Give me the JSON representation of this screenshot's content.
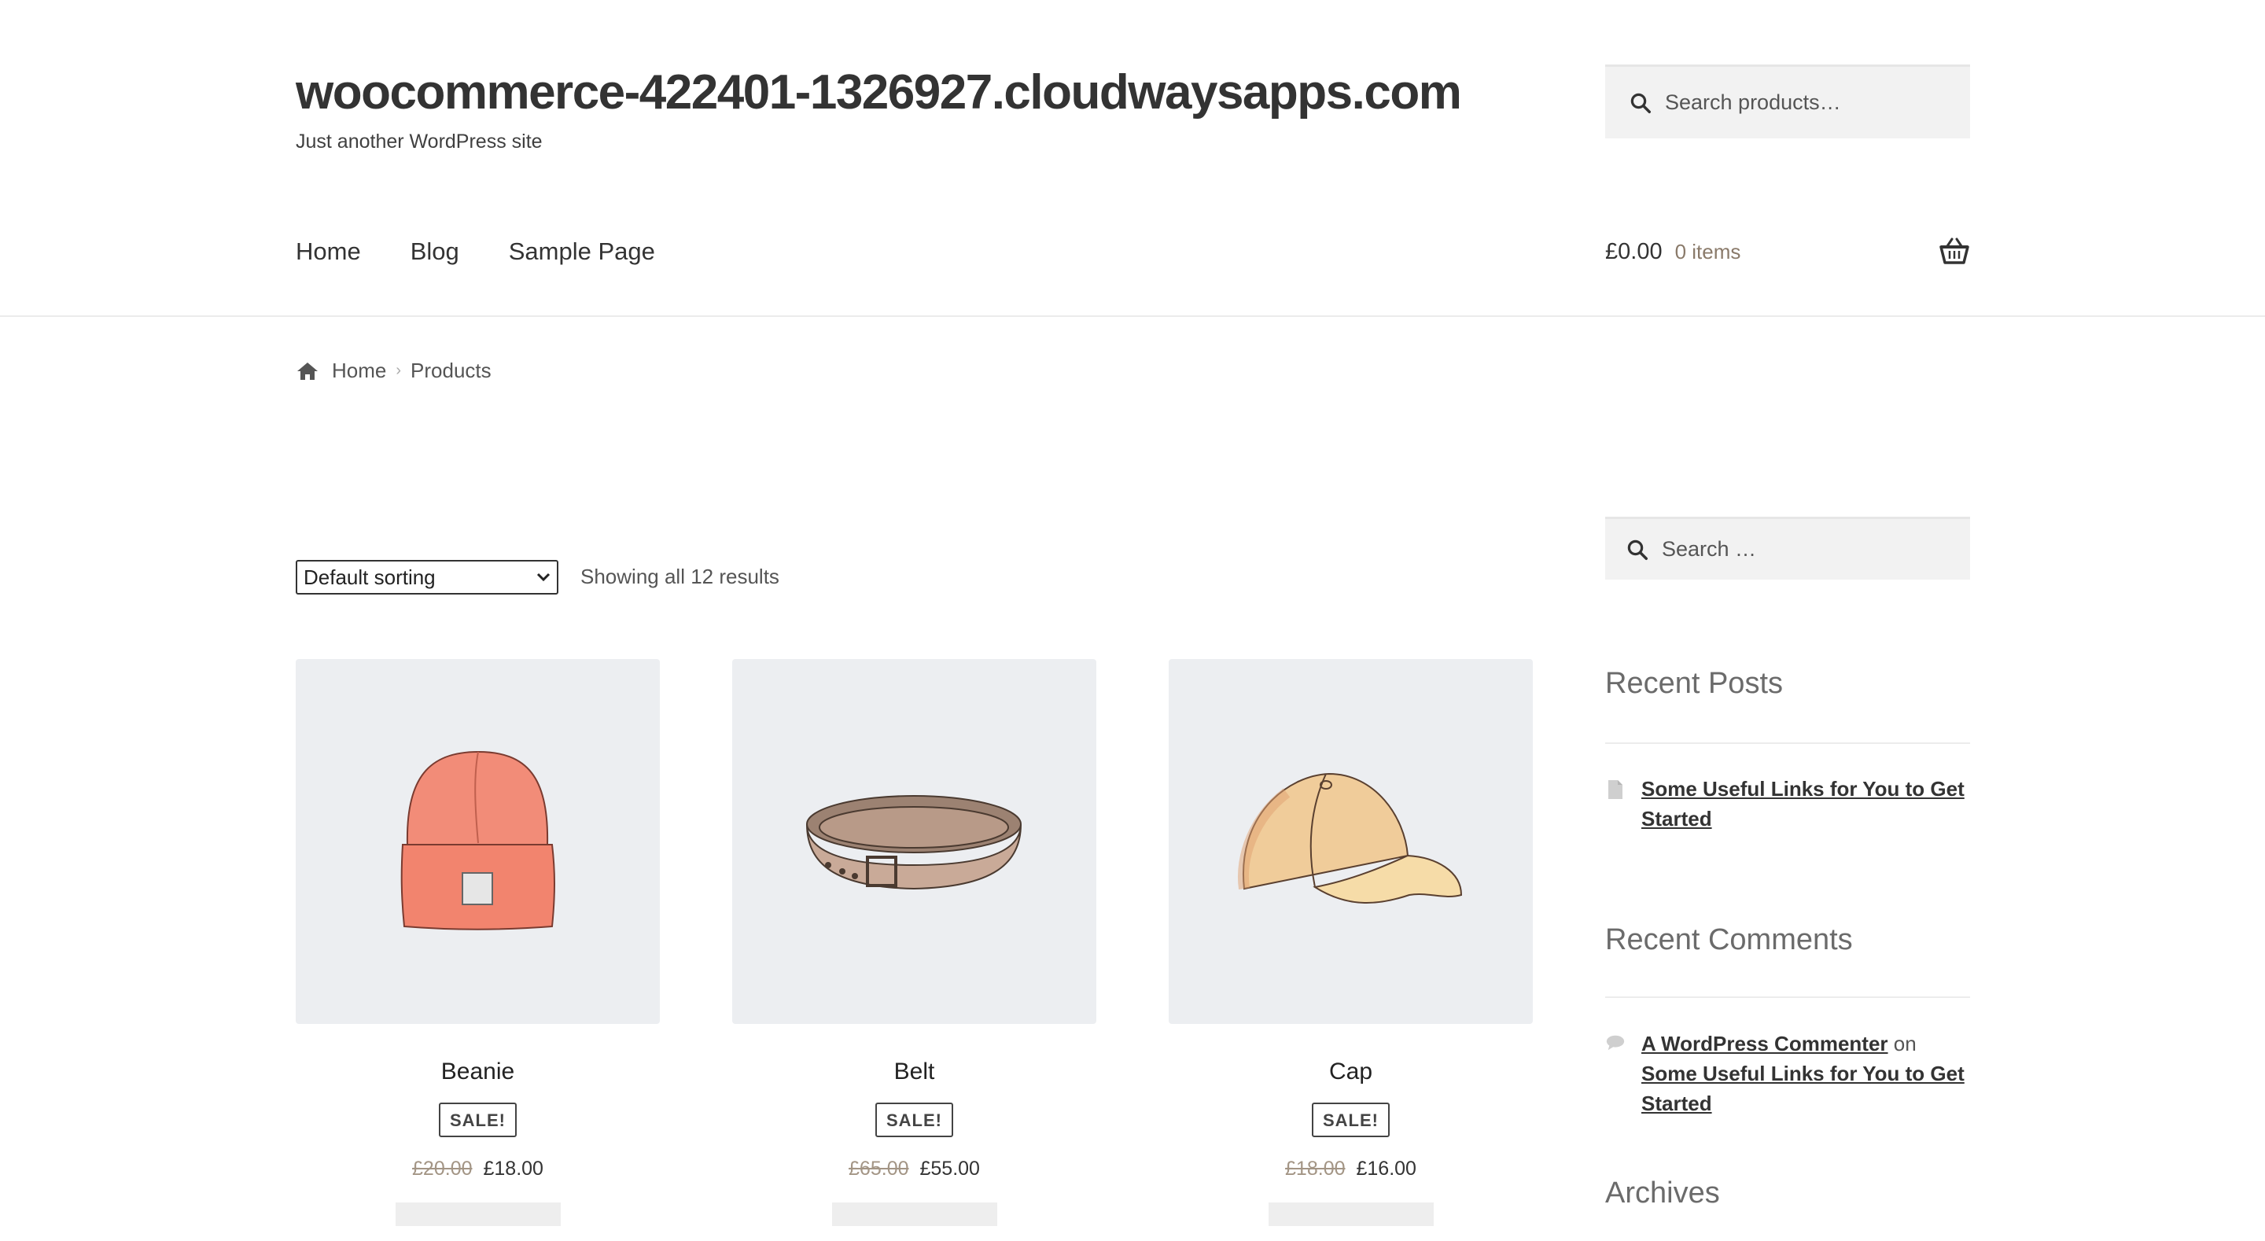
{
  "site": {
    "title": "woocommerce-422401-1326927.cloudwaysapps.com",
    "tagline": "Just another WordPress site"
  },
  "header_search": {
    "placeholder": "Search products…"
  },
  "nav": [
    {
      "label": "Home"
    },
    {
      "label": "Blog"
    },
    {
      "label": "Sample Page"
    }
  ],
  "cart": {
    "amount": "£0.00",
    "items": "0 items",
    "icon": "basket-icon"
  },
  "breadcrumb": {
    "home": "Home",
    "current": "Products"
  },
  "toolbar": {
    "sorting": "Default sorting",
    "result_count": "Showing all 12 results"
  },
  "products": [
    {
      "name": "Beanie",
      "badge": "SALE!",
      "old_price": "£20.00",
      "price": "£18.00",
      "image": "beanie"
    },
    {
      "name": "Belt",
      "badge": "SALE!",
      "old_price": "£65.00",
      "price": "£55.00",
      "image": "belt"
    },
    {
      "name": "Cap",
      "badge": "SALE!",
      "old_price": "£18.00",
      "price": "£16.00",
      "image": "cap"
    }
  ],
  "sidebar": {
    "search_placeholder": "Search …",
    "recent_posts": {
      "title": "Recent Posts",
      "items": [
        {
          "label": "Some Useful Links for You to Get Started"
        }
      ]
    },
    "recent_comments": {
      "title": "Recent Comments",
      "items": [
        {
          "author": "A WordPress Commenter",
          "on": "on",
          "post": "Some Useful Links for You to Get Started"
        }
      ]
    },
    "archives": {
      "title": "Archives"
    }
  }
}
